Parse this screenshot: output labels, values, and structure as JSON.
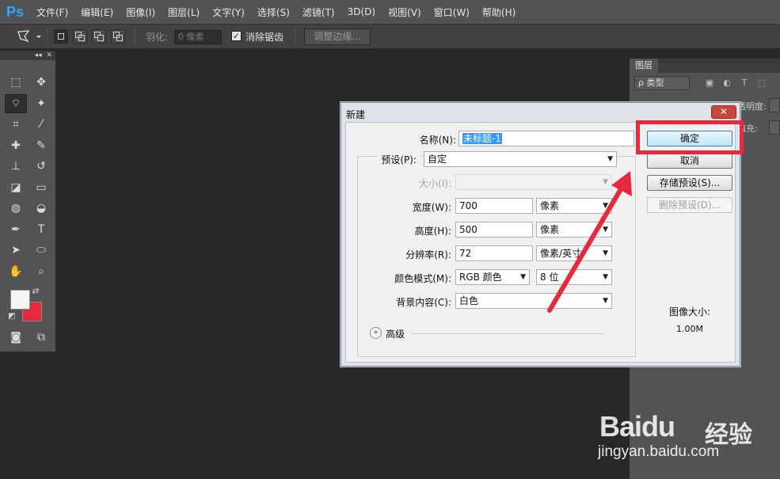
{
  "app": {
    "logo": "Ps"
  },
  "menu": [
    "文件(F)",
    "编辑(E)",
    "图像(I)",
    "图层(L)",
    "文字(Y)",
    "选择(S)",
    "滤镜(T)",
    "3D(D)",
    "视图(V)",
    "窗口(W)",
    "帮助(H)"
  ],
  "options_bar": {
    "feather_label": "羽化:",
    "feather_value": "0 像素",
    "antialias_label": "消除锯齿",
    "antialias_checked": true,
    "refine_edge_label": "调整边缘..."
  },
  "toolbox": {
    "collapse_icon": "◂◂",
    "close_icon": "✕",
    "tools": [
      {
        "name": "marquee-tool-icon",
        "glyph": "⬚"
      },
      {
        "name": "move-tool-icon",
        "glyph": "✥"
      },
      {
        "name": "polygonal-lasso-tool-icon",
        "glyph": "⌔"
      },
      {
        "name": "magic-wand-tool-icon",
        "glyph": "✦"
      },
      {
        "name": "crop-tool-icon",
        "glyph": "⌗"
      },
      {
        "name": "eyedropper-tool-icon",
        "glyph": "⁄"
      },
      {
        "name": "healing-brush-tool-icon",
        "glyph": "✚"
      },
      {
        "name": "brush-tool-icon",
        "glyph": "✎"
      },
      {
        "name": "clone-stamp-tool-icon",
        "glyph": "⊥"
      },
      {
        "name": "history-brush-tool-icon",
        "glyph": "↺"
      },
      {
        "name": "eraser-tool-icon",
        "glyph": "◪"
      },
      {
        "name": "gradient-tool-icon",
        "glyph": "▭"
      },
      {
        "name": "blur-tool-icon",
        "glyph": "◍"
      },
      {
        "name": "dodge-tool-icon",
        "glyph": "◒"
      },
      {
        "name": "pen-tool-icon",
        "glyph": "✒"
      },
      {
        "name": "type-tool-icon",
        "glyph": "T"
      },
      {
        "name": "path-selection-tool-icon",
        "glyph": "➤"
      },
      {
        "name": "ellipse-tool-icon",
        "glyph": "⬭"
      },
      {
        "name": "hand-tool-icon",
        "glyph": "✋"
      },
      {
        "name": "zoom-tool-icon",
        "glyph": "⌕"
      }
    ],
    "foreground_color": "#f4f4f4",
    "background_color": "#e8283c"
  },
  "layers_panel": {
    "tab": "图层",
    "kind_filter": "ρ 类型",
    "opacity_label": "透明度:",
    "fill_label": "填充:"
  },
  "dialog": {
    "title": "新建",
    "close_glyph": "✕",
    "name_label": "名称(N):",
    "name_value": "未标题-1",
    "preset_label": "预设(P):",
    "preset_value": "自定",
    "size_label": "大小(I):",
    "size_value": "",
    "width_label": "宽度(W):",
    "width_value": "700",
    "width_unit": "像素",
    "height_label": "高度(H):",
    "height_value": "500",
    "height_unit": "像素",
    "resolution_label": "分辨率(R):",
    "resolution_value": "72",
    "resolution_unit": "像素/英寸",
    "color_mode_label": "颜色模式(M):",
    "color_mode_value": "RGB 颜色",
    "bit_depth_value": "8 位",
    "background_label": "背景内容(C):",
    "background_value": "白色",
    "advanced_label": "高级",
    "ok_label": "确定",
    "cancel_label": "取消",
    "save_preset_label": "存储预设(S)...",
    "delete_preset_label": "删除预设(D)...",
    "image_size_label": "图像大小:",
    "image_size_value": "1.00M"
  },
  "annotation": {
    "highlight_color": "#e8283c"
  },
  "watermark": {
    "brand": "Baidu",
    "cn": "经验",
    "url": "jingyan.baidu.com"
  }
}
